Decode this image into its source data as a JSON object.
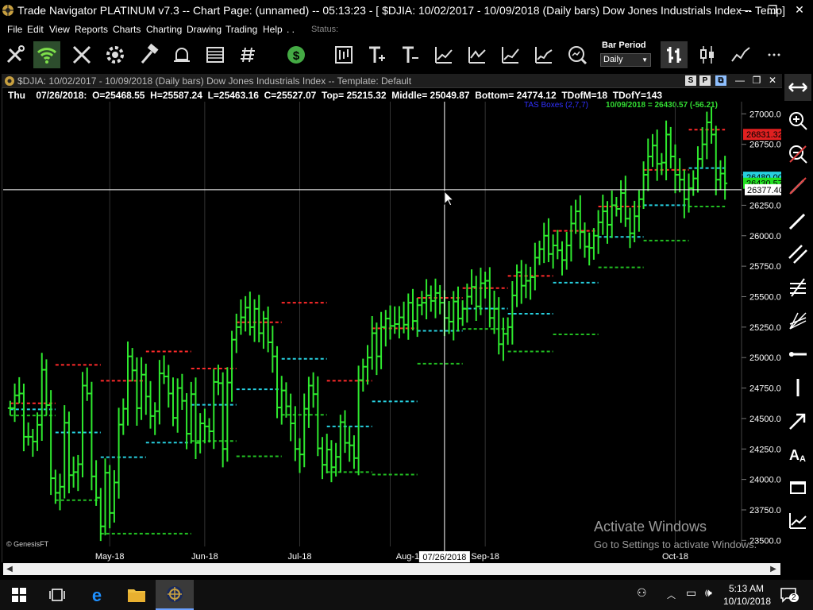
{
  "window": {
    "title": "Trade Navigator PLATINUM v7.3  --  Chart Page: (unnamed) -- 05:13:23 - [ $DJIA:  10/02/2017 - 10/09/2018  (Daily bars)   Dow Jones Industrials Index  --  Temp]",
    "minimize": "—",
    "restore": "❐",
    "close": "✕"
  },
  "menu": {
    "items": [
      "File",
      "Edit",
      "View",
      "Reports",
      "Charts",
      "Charting",
      "Drawing",
      "Trading",
      "Help",
      ". ."
    ],
    "status_label": "Status:"
  },
  "toolbar": {
    "bar_period_label": "Bar Period",
    "bar_period_value": "Daily",
    "icons": [
      "wrench-pencil-icon",
      "wifi-icon",
      "tools-icon",
      "gear-icon",
      "hammer-icon",
      "alarm-bell-icon",
      "table-icon",
      "list-icon",
      "dollar-icon",
      "chart-book-icon",
      "add-text-icon",
      "remove-text-icon",
      "chart-up-1-icon",
      "chart-up-2-icon",
      "chart-up-3-icon",
      "chart-up-4-icon",
      "chart-eye-icon",
      "bar-style-icon",
      "candle-style-icon",
      "line-style-icon",
      "more-icon"
    ]
  },
  "chart_window": {
    "title": "$DJIA:  10/02/2017 - 10/09/2018  (Daily bars)   Dow Jones Industrials Index  --  Template: Default",
    "btn_s": "S",
    "btn_p": "P",
    "ohlc": {
      "day": "Thu",
      "date": "07/26/2018:",
      "open": "O=25468.55",
      "high": "H=25587.24",
      "low": "L=25463.16",
      "close": "C=25527.07",
      "top": "Top= 25215.32",
      "middle": "Middle= 25049.87",
      "bottom": "Bottom= 24774.12",
      "tdofm": "TDofM=18",
      "tdofy": "TDofY=143"
    },
    "tas_label": "TAS Boxes (2,7,7)",
    "last_label": "10/09/2018 = 26430.57 (-56.21)",
    "copyright": "© GenesisFT",
    "crosshair_price": "26377.40",
    "crosshair_date": "07/26/2018",
    "price_marker_red": "26831.32",
    "price_marker_cyan": "26480.00",
    "price_marker_green": "26430.57"
  },
  "chart_data": {
    "type": "ohlc",
    "symbol": "$DJIA",
    "y_ticks": [
      23500,
      23750,
      24000,
      24250,
      24500,
      24750,
      25000,
      25250,
      25500,
      25750,
      26000,
      26250,
      26500,
      26750,
      27000
    ],
    "x_labels": [
      "May-18",
      "Jun-18",
      "Jul-18",
      "Aug-18",
      "Sep-18",
      "Oct-18"
    ],
    "ylim": [
      23450,
      27100
    ],
    "closes": [
      24585,
      24690,
      24705,
      24350,
      24350,
      24311,
      24448,
      24900,
      24610,
      24010,
      23890,
      23940,
      24465,
      24035,
      24060,
      24125,
      24770,
      24705,
      24025,
      23850,
      23615,
      24055,
      23725,
      23975,
      24450,
      24580,
      25010,
      24895,
      24585,
      24860,
      24680,
      24520,
      24560,
      24870,
      24845,
      24705,
      24505,
      24750,
      24645,
      24375,
      24700,
      24300,
      24460,
      24435,
      24395,
      24800,
      24790,
      24250,
      24795,
      25147,
      25250,
      25330,
      25410,
      25250,
      25400,
      25200,
      25320,
      25125,
      25010,
      24590,
      24730,
      24600,
      24460,
      24250,
      24205,
      24580,
      24770,
      24700,
      24255,
      24120,
      24245,
      24100,
      24185,
      24470,
      24300,
      24280,
      24175,
      24815,
      24925,
      25000,
      25200,
      25010,
      25250,
      25320,
      25260,
      25275,
      25330,
      25270,
      25450,
      25300,
      25430,
      25450,
      25510,
      25465,
      25530,
      25450,
      25325,
      25295,
      25460,
      25320,
      25400,
      25500,
      25580,
      25420,
      25610,
      25630,
      25325,
      25400,
      25110,
      25195,
      25250,
      25510,
      25700,
      25590,
      25630,
      25660,
      25820,
      25890,
      26000,
      25850,
      25920,
      25880,
      25800,
      25920,
      26100,
      26200,
      26030,
      25910,
      25900,
      26000,
      26110,
      26200,
      26090,
      26250,
      26220,
      26350,
      26140,
      26020,
      26160,
      26300,
      26500,
      26650,
      26740,
      26590,
      26600,
      26830,
      26650,
      26500,
      26460,
      26300,
      26390,
      26470,
      26630,
      26750,
      26930,
      26830,
      26460,
      26510,
      26430
    ]
  },
  "sidebar_icons": [
    "pan-icon",
    "zoom-in-icon",
    "zoom-out-icon",
    "draw-icon",
    "pencil-icon",
    "parallel-lines-icon",
    "fib-icon",
    "gann-icon",
    "horizontal-line-icon",
    "vertical-line-icon",
    "arrow-icon",
    "text-icon",
    "rectangle-icon",
    "chart-insert-icon"
  ],
  "watermark": {
    "title": "Activate Windows",
    "subtitle": "Go to Settings to activate Windows."
  },
  "taskbar": {
    "time": "5:13 AM",
    "date": "10/10/2018",
    "notification_count": "2"
  }
}
